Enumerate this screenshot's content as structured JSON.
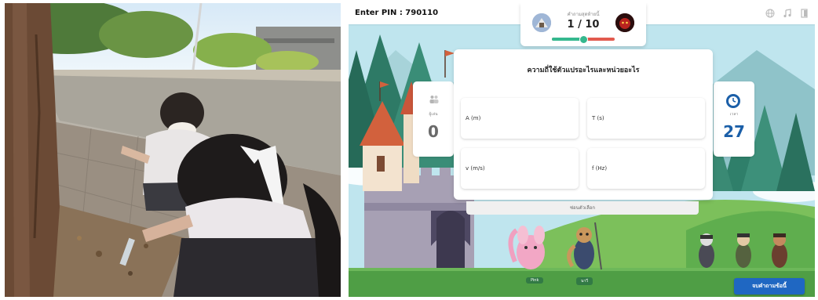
{
  "game": {
    "pin_text": "Enter PIN : 790110",
    "progress": {
      "caption": "คำถามสุดท้ายนี้",
      "count_text": "1 / 10",
      "fraction": 0.5
    },
    "players_card": {
      "caption": "ผู้เล่น",
      "value": "0"
    },
    "timer_card": {
      "caption": "เวลา",
      "value": "27"
    },
    "question": {
      "text": "ความถี่ใช้ตัวแปรอะไรและหน่วยอะไร",
      "answers": [
        "A (m)",
        "T (s)",
        "v (m/s)",
        "f (Hz)"
      ]
    },
    "hide_options_label": "ซ่อนตัวเลือก",
    "character_labels": [
      "Pink",
      "นาวี"
    ],
    "end_button_label": "จบคำถามข้อนี้",
    "icons": [
      "globe-icon",
      "music-icon",
      "exit-icon",
      "people-icon",
      "clock-icon"
    ],
    "colors": {
      "accent": "#1f67c2",
      "timer": "#1b5fa8",
      "progress_done": "#35b88e",
      "progress_left": "#e25a4e"
    }
  }
}
